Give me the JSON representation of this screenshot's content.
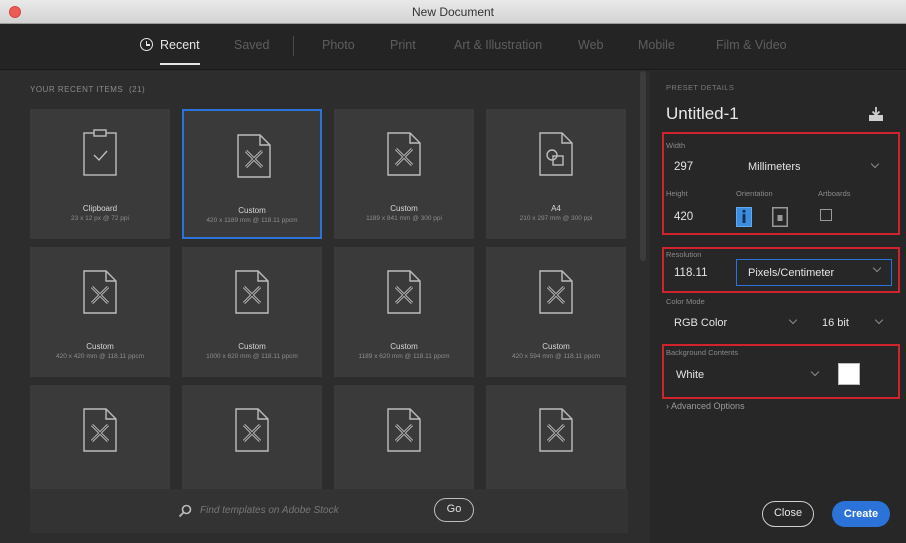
{
  "window": {
    "title": "New Document"
  },
  "tabs": [
    {
      "label": "Recent",
      "active": true
    },
    {
      "label": "Saved"
    },
    {
      "label": "Photo"
    },
    {
      "label": "Print"
    },
    {
      "label": "Art & Illustration"
    },
    {
      "label": "Web"
    },
    {
      "label": "Mobile"
    },
    {
      "label": "Film & Video"
    }
  ],
  "recent": {
    "label": "YOUR RECENT ITEMS",
    "count": "(21)",
    "items": [
      {
        "name": "Clipboard",
        "dims": "23 x 12 px @ 72 ppi",
        "icon": "clipboard-icon"
      },
      {
        "name": "Custom",
        "dims": "420 x 1189 mm @ 118.11 ppcm",
        "icon": "custom-document-icon",
        "selected": true
      },
      {
        "name": "Custom",
        "dims": "1189 x 841 mm @ 300 ppi",
        "icon": "custom-document-icon"
      },
      {
        "name": "A4",
        "dims": "210 x 297 mm @ 300 ppi",
        "icon": "print-document-icon"
      },
      {
        "name": "Custom",
        "dims": "420 x 420 mm @ 118.11 ppcm",
        "icon": "custom-document-icon"
      },
      {
        "name": "Custom",
        "dims": "1000 x 620 mm @ 118.11 ppcm",
        "icon": "custom-document-icon"
      },
      {
        "name": "Custom",
        "dims": "1189 x 620 mm @ 118.11 ppcm",
        "icon": "custom-document-icon"
      },
      {
        "name": "Custom",
        "dims": "420 x 594 mm @ 118.11 ppcm",
        "icon": "custom-document-icon"
      },
      {
        "name": "",
        "dims": "",
        "icon": "custom-document-icon"
      },
      {
        "name": "",
        "dims": "",
        "icon": "custom-document-icon"
      },
      {
        "name": "",
        "dims": "",
        "icon": "custom-document-icon"
      },
      {
        "name": "",
        "dims": "",
        "icon": "custom-document-icon"
      }
    ]
  },
  "search": {
    "placeholder": "Find templates on Adobe Stock",
    "go_label": "Go"
  },
  "preset": {
    "section_label": "PRESET DETAILS",
    "name": "Untitled-1",
    "width_label": "Width",
    "width_value": "297",
    "width_unit": "Millimeters",
    "height_label": "Height",
    "height_value": "420",
    "orientation_label": "Orientation",
    "orientation": "portrait",
    "artboards_label": "Artboards",
    "artboards_checked": false,
    "resolution_label": "Resolution",
    "resolution_value": "118.11",
    "resolution_unit": "Pixels/Centimeter",
    "color_mode_label": "Color Mode",
    "color_mode": "RGB Color",
    "bit_depth": "16 bit",
    "background_label": "Background Contents",
    "background": "White",
    "background_color": "#ffffff",
    "advanced_label": "Advanced Options"
  },
  "buttons": {
    "close": "Close",
    "create": "Create"
  },
  "colors": {
    "accent": "#2b73d9",
    "highlight_box": "#d0232b"
  }
}
